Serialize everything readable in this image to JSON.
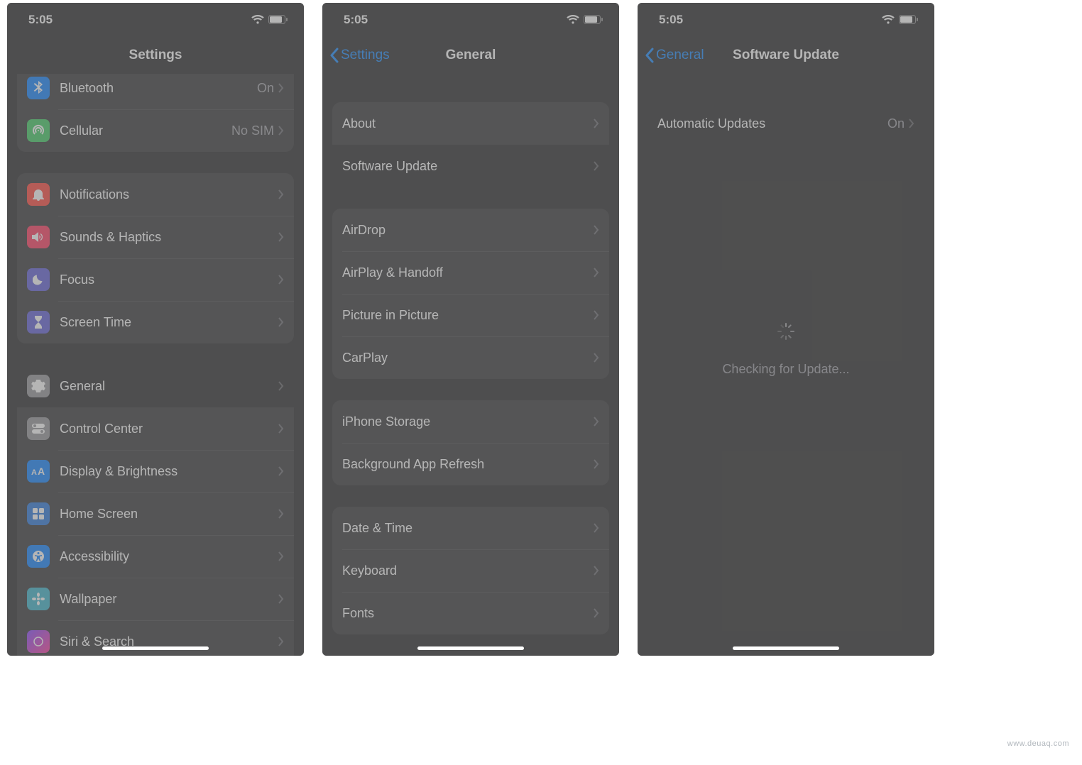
{
  "status": {
    "time": "5:05"
  },
  "screens": {
    "settings": {
      "title": "Settings",
      "rows": {
        "bluetooth": {
          "label": "Bluetooth",
          "value": "On"
        },
        "cellular": {
          "label": "Cellular",
          "value": "No SIM"
        },
        "notifications": {
          "label": "Notifications"
        },
        "sounds": {
          "label": "Sounds & Haptics"
        },
        "focus": {
          "label": "Focus"
        },
        "screentime": {
          "label": "Screen Time"
        },
        "general": {
          "label": "General"
        },
        "controlcenter": {
          "label": "Control Center"
        },
        "display": {
          "label": "Display & Brightness"
        },
        "homescreen": {
          "label": "Home Screen"
        },
        "accessibility": {
          "label": "Accessibility"
        },
        "wallpaper": {
          "label": "Wallpaper"
        },
        "siri": {
          "label": "Siri & Search"
        }
      }
    },
    "general": {
      "back": "Settings",
      "title": "General",
      "rows": {
        "about": {
          "label": "About"
        },
        "software": {
          "label": "Software Update"
        },
        "airdrop": {
          "label": "AirDrop"
        },
        "airplay": {
          "label": "AirPlay & Handoff"
        },
        "pip": {
          "label": "Picture in Picture"
        },
        "carplay": {
          "label": "CarPlay"
        },
        "storage": {
          "label": "iPhone Storage"
        },
        "bgrefresh": {
          "label": "Background App Refresh"
        },
        "datetime": {
          "label": "Date & Time"
        },
        "keyboard": {
          "label": "Keyboard"
        },
        "fonts": {
          "label": "Fonts"
        }
      }
    },
    "software_update": {
      "back": "General",
      "title": "Software Update",
      "rows": {
        "auto": {
          "label": "Automatic Updates",
          "value": "On"
        }
      },
      "loading": "Checking for Update..."
    }
  },
  "watermark": "www.deuaq.com"
}
